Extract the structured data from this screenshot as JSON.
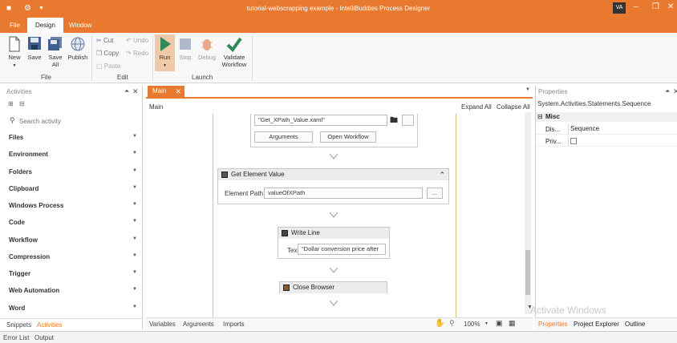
{
  "window": {
    "title": "tutorial-webscrapping example - IntelliBuddies Process Designer",
    "avatar": "VA"
  },
  "menu": [
    {
      "label": "File"
    },
    {
      "label": "Design"
    },
    {
      "label": "Window"
    }
  ],
  "ribbon": {
    "file_group": {
      "label": "File",
      "new": "New",
      "save": "Save",
      "save_all_1": "Save",
      "save_all_2": "All",
      "publish": "Publish"
    },
    "edit_group": {
      "label": "Edit",
      "cut": "Cut",
      "copy": "Copy",
      "paste": "Paste",
      "undo": "Undo",
      "redo": "Redo"
    },
    "launch_group": {
      "label": "Launch",
      "run": "Run",
      "stop": "Stop",
      "debug": "Debug",
      "validate_1": "Validate",
      "validate_2": "Workflow"
    }
  },
  "activities_panel": {
    "title": "Activities",
    "search_placeholder": "Search activity",
    "categories": [
      "Files",
      "Environment",
      "Folders",
      "Clipboard",
      "Windows Process",
      "Code",
      "Workflow",
      "Compression",
      "Trigger",
      "Web Automation",
      "Word"
    ],
    "tabs": [
      "Snippets",
      "Activities"
    ]
  },
  "designer": {
    "tab": "Main",
    "breadcrumb": "Main",
    "expand_all": "Expand All",
    "collapse_all": "Collapse All",
    "invoke": {
      "file": "\"Get_XPath_Value.xaml\"",
      "arguments": "Arguments",
      "open": "Open Workflow"
    },
    "get_element": {
      "title": "Get Element Value",
      "label": "Element Path",
      "value": "valueOfXPath",
      "browse": "..."
    },
    "write_line": {
      "title": "Write Line",
      "label": "Text",
      "value": "\"Dollar conversion price after"
    },
    "close_browser": {
      "title": "Close Browser"
    },
    "bottom_tabs": [
      "Variables",
      "Arguments",
      "Imports"
    ],
    "zoom": "100%"
  },
  "properties": {
    "title": "Properties",
    "type": "System.Activities.Statements.Sequence",
    "category": "Misc",
    "rows": [
      {
        "name": "Dis...",
        "value": "Sequence"
      },
      {
        "name": "Priv...",
        "value": ""
      }
    ],
    "tabs": [
      "Properties",
      "Project Explorer",
      "Outline"
    ]
  },
  "footer": [
    "Error List",
    "Output"
  ],
  "watermark": "Activate Windows",
  "colors": {
    "accent": "#e8792e",
    "run": "#2e8b57",
    "validate": "#2e8b57"
  }
}
